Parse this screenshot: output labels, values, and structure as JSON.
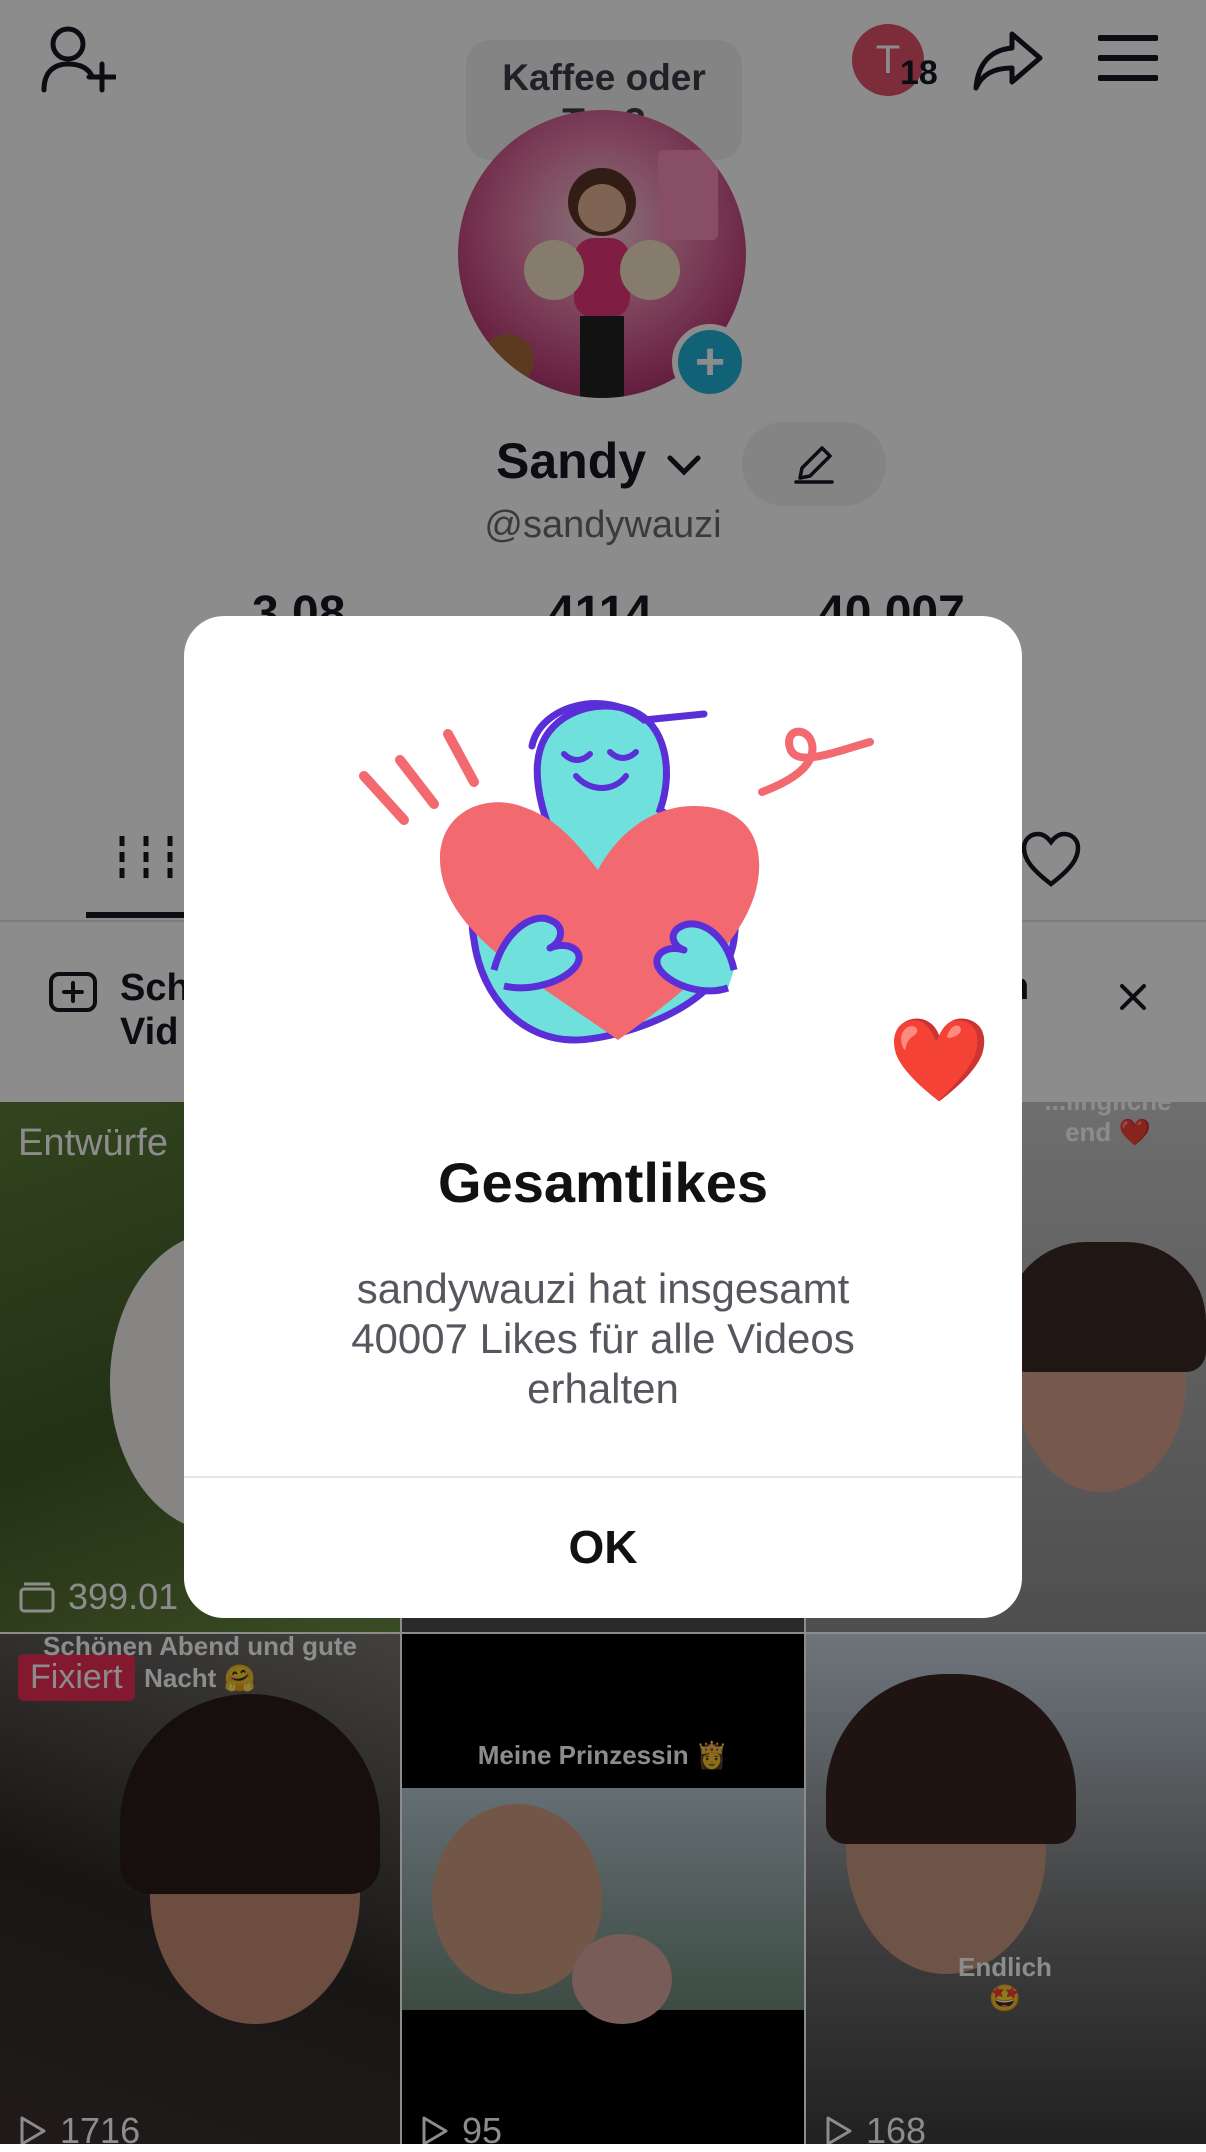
{
  "header": {
    "add_friend_icon": "person-plus-icon",
    "status_bubble": [
      "Kaffee oder",
      "Tee?"
    ],
    "avatar_initial": "T",
    "notification_count": "18",
    "share_icon": "share-arrow-icon",
    "menu_icon": "hamburger-menu-icon"
  },
  "profile": {
    "name": "Sandy",
    "handle": "@sandywauzi",
    "stats_partial": [
      "3.08",
      "4114",
      "40.007"
    ]
  },
  "create_bar": {
    "text_line1": "Sch",
    "text_line2": "Vid",
    "right_fragment": "n",
    "close_icon": "close-icon"
  },
  "grid": {
    "drafts_label": "Entwürfe",
    "drafts_count": "399.01",
    "top_right_overlay": [
      "...lingliche",
      "end ❤️"
    ],
    "items": [
      {
        "badge": "Fixiert",
        "caption": "Schönen Abend und gute Nacht 🤗",
        "plays": "1716"
      },
      {
        "caption": "Meine Prinzessin 👸",
        "plays": "95"
      },
      {
        "caption": "Endlich 🤩",
        "plays": "168"
      }
    ]
  },
  "dialog": {
    "title": "Gesamtlikes",
    "body": "sandywauzi hat insgesamt 40007 Likes für alle Videos erhalten",
    "ok": "OK",
    "heart_emoji": "❤️"
  },
  "colors": {
    "accent_pink": "#ee2e56",
    "heart": "#f2696f",
    "figure": "#6fe0dc",
    "outline": "#5b2fd8"
  }
}
